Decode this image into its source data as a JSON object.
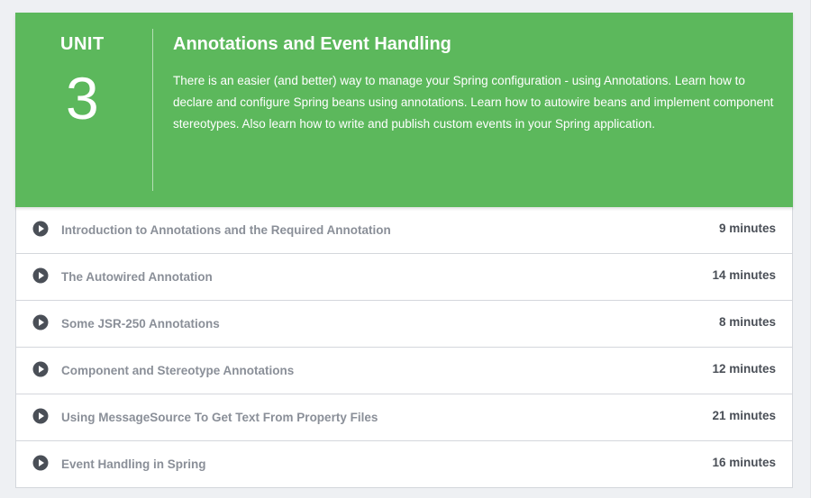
{
  "unit": {
    "label": "UNIT",
    "number": "3",
    "title": "Annotations and Event Handling",
    "description": "There is an easier (and better) way to manage your Spring configuration - using Annotations. Learn how to declare and configure Spring beans using annotations. Learn how to autowire beans and implement component stereotypes. Also learn how to write and publish custom events in your Spring application.",
    "header_color": "#5cb85c"
  },
  "lessons": [
    {
      "title": "Introduction to Annotations and the Required Annotation",
      "duration": "9 minutes",
      "icon": "play-circle-icon"
    },
    {
      "title": "The Autowired Annotation",
      "duration": "14 minutes",
      "icon": "play-circle-icon"
    },
    {
      "title": "Some JSR-250 Annotations",
      "duration": "8 minutes",
      "icon": "play-circle-icon"
    },
    {
      "title": "Component and Stereotype Annotations",
      "duration": "12 minutes",
      "icon": "play-circle-icon"
    },
    {
      "title": "Using MessageSource To Get Text From Property Files",
      "duration": "21 minutes",
      "icon": "play-circle-icon"
    },
    {
      "title": "Event Handling in Spring",
      "duration": "16 minutes",
      "icon": "play-circle-icon"
    }
  ]
}
